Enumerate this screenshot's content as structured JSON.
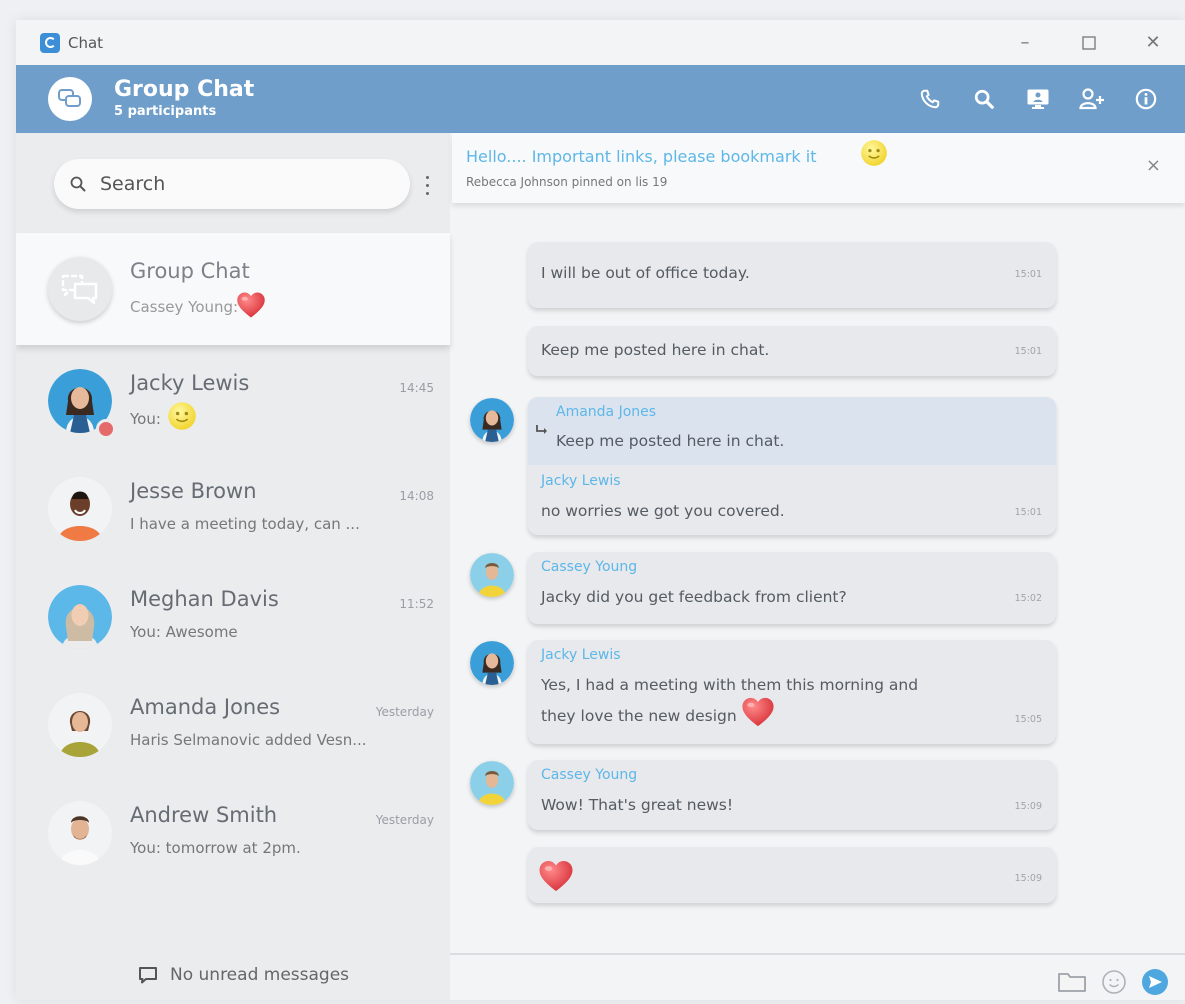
{
  "app": {
    "title": "Chat"
  },
  "window_controls": {
    "minimize": "–",
    "maximize": "☐",
    "close": "✕"
  },
  "header": {
    "title": "Group Chat",
    "subtitle": "5 participants",
    "actions": [
      "phone-icon",
      "search-icon",
      "screen-share-icon",
      "add-user-icon",
      "info-icon"
    ]
  },
  "search": {
    "placeholder": "Search"
  },
  "conversations": [
    {
      "name": "Group Chat",
      "preview": "Cassey Young:",
      "preview_emoji": "heart",
      "time": "",
      "active": true
    },
    {
      "name": "Jacky Lewis",
      "preview": "You:",
      "preview_emoji": "smile",
      "time": "14:45",
      "presence": "busy"
    },
    {
      "name": "Jesse Brown",
      "preview": "I have a meeting today, can ...",
      "time": "14:08"
    },
    {
      "name": "Meghan Davis",
      "preview": "You: Awesome",
      "time": "11:52"
    },
    {
      "name": "Amanda Jones",
      "preview": "Haris Selmanovic added Vesn...",
      "time": "Yesterday"
    },
    {
      "name": "Andrew Smith",
      "preview": "You: tomorrow at 2pm.",
      "time": "Yesterday"
    }
  ],
  "footer": {
    "no_unread": "No unread messages"
  },
  "pinned": {
    "text": "Hello.... Important links, please bookmark it",
    "subtitle": "Rebecca Johnson pinned on lis 19",
    "close": "×"
  },
  "messages": [
    {
      "text": "I will be out of office today.",
      "time": "15:01"
    },
    {
      "text": "Keep me posted here in chat.",
      "time": "15:01"
    },
    {
      "quote_sender": "Amanda Jones",
      "quote_text": "Keep me posted here in chat.",
      "sender": "Jacky Lewis",
      "text": "no worries we got you covered.",
      "time": "15:01"
    },
    {
      "sender": "Cassey Young",
      "text": "Jacky did you get feedback from client?",
      "time": "15:02"
    },
    {
      "sender": "Jacky Lewis",
      "text": "Yes, I had a meeting with them this morning and",
      "text2": "they love the new design",
      "time": "15:05"
    },
    {
      "sender": "Cassey Young",
      "text": "Wow! That's great news!",
      "time": "15:09"
    },
    {
      "emoji": "heart",
      "time": "15:09"
    }
  ],
  "colors": {
    "header": "#6f9ecb",
    "accent": "#5db7e8",
    "busy": "#e56a6a"
  }
}
